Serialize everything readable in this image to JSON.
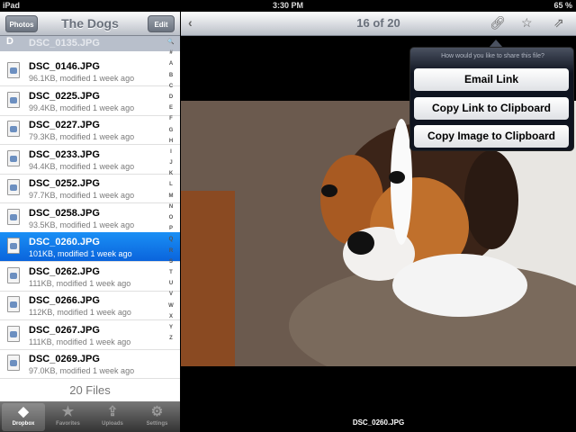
{
  "status": {
    "device": "iPad",
    "time": "3:30 PM",
    "battery": "65 %"
  },
  "sidebar": {
    "back": "Photos",
    "title": "The Dogs",
    "edit": "Edit",
    "section": "D",
    "ghost": "DSC_0135.JPG",
    "files": [
      {
        "name": "DSC_0146.JPG",
        "meta": "96.1KB, modified 1 week ago"
      },
      {
        "name": "DSC_0225.JPG",
        "meta": "99.4KB, modified 1 week ago"
      },
      {
        "name": "DSC_0227.JPG",
        "meta": "79.3KB, modified 1 week ago"
      },
      {
        "name": "DSC_0233.JPG",
        "meta": "94.4KB, modified 1 week ago"
      },
      {
        "name": "DSC_0252.JPG",
        "meta": "97.7KB, modified 1 week ago"
      },
      {
        "name": "DSC_0258.JPG",
        "meta": "93.5KB, modified 1 week ago"
      },
      {
        "name": "DSC_0260.JPG",
        "meta": "101KB, modified 1 week ago",
        "selected": true
      },
      {
        "name": "DSC_0262.JPG",
        "meta": "111KB, modified 1 week ago"
      },
      {
        "name": "DSC_0266.JPG",
        "meta": "112KB, modified 1 week ago"
      },
      {
        "name": "DSC_0267.JPG",
        "meta": "111KB, modified 1 week ago"
      },
      {
        "name": "DSC_0269.JPG",
        "meta": "97.0KB, modified 1 week ago"
      }
    ],
    "index": [
      "🔍",
      "#",
      "A",
      "B",
      "C",
      "D",
      "E",
      "F",
      "G",
      "H",
      "I",
      "J",
      "K",
      "L",
      "M",
      "N",
      "O",
      "P",
      "Q",
      "R",
      "S",
      "T",
      "U",
      "V",
      "W",
      "X",
      "Y",
      "Z"
    ],
    "count": "20 Files",
    "tabs": [
      {
        "label": "Dropbox",
        "icon": "◆"
      },
      {
        "label": "Favorites",
        "icon": "★"
      },
      {
        "label": "Uploads",
        "icon": "⇪"
      },
      {
        "label": "Settings",
        "icon": "⚙"
      }
    ]
  },
  "viewer": {
    "position": "16 of 20",
    "caption": "DSC_0260.JPG"
  },
  "share": {
    "question": "How would you like to share this file?",
    "options": [
      "Email Link",
      "Copy Link to Clipboard",
      "Copy Image to Clipboard"
    ]
  }
}
